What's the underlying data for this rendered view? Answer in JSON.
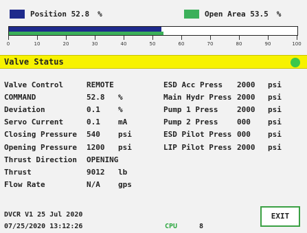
{
  "header": {
    "position_label": "Position 52.8",
    "position_unit": "%",
    "position_color": "#1e2a8c",
    "position_value": 52.8,
    "open_label": "Open Area 53.5",
    "open_unit": "%",
    "open_color": "#3cb05a",
    "open_value": 53.5
  },
  "scale": {
    "ticks": [
      "0",
      "10",
      "20",
      "30",
      "40",
      "50",
      "60",
      "70",
      "80",
      "90",
      "100"
    ]
  },
  "status": {
    "title": "Valve Status",
    "indicator_color": "#3cc84a"
  },
  "left_rows": [
    {
      "label": "Valve Control",
      "value": "REMOTE",
      "unit": ""
    },
    {
      "label": "COMMAND",
      "value": "52.8",
      "unit": "%"
    },
    {
      "label": "Deviation",
      "value": "0.1",
      "unit": "%"
    },
    {
      "label": "Servo Current",
      "value": "0.1",
      "unit": "mA"
    },
    {
      "label": "Closing Pressure",
      "value": "540",
      "unit": "psi"
    },
    {
      "label": "Opening Pressure",
      "value": "1200",
      "unit": "psi"
    },
    {
      "label": "Thrust Direction",
      "value": "OPENING",
      "unit": ""
    },
    {
      "label": "Thrust",
      "value": "9012",
      "unit": "lb"
    },
    {
      "label": "Flow Rate",
      "value": "N/A",
      "unit": "gps"
    }
  ],
  "right_rows": [
    {
      "label": "ESD Acc Press",
      "value": "2000",
      "unit": "psi"
    },
    {
      "label": "Main Hydr Press",
      "value": "2000",
      "unit": "psi"
    },
    {
      "label": "Pump 1 Press",
      "value": "2000",
      "unit": "psi"
    },
    {
      "label": "Pump 2 Press",
      "value": "000",
      "unit": "psi"
    },
    {
      "label": "ESD Pilot Press",
      "value": "000",
      "unit": "psi"
    },
    {
      "label": "LIP Pilot Press",
      "value": "2000",
      "unit": "psi"
    }
  ],
  "footer": {
    "version": "DVCR V1 25 Jul 2020",
    "datetime": "07/25/2020 13:12:26",
    "cpu_label": "CPU",
    "cpu_value": "8"
  },
  "exit_label": "EXIT"
}
